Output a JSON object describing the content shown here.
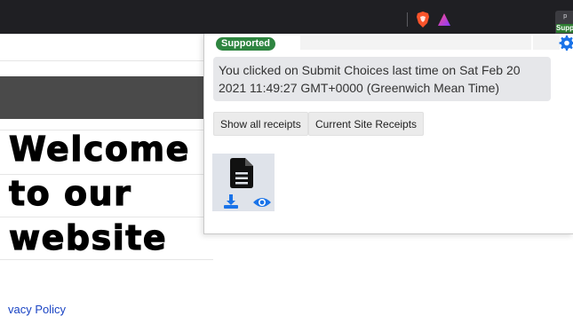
{
  "toolbar": {
    "extension_letter": "p",
    "extension_badge": "Supported"
  },
  "page": {
    "heading_lines": [
      "Welcome",
      "to our",
      "website"
    ],
    "privacy_link": "vacy Policy"
  },
  "popup": {
    "status_badge": "Supported",
    "message": "You clicked on Submit Choices last time on Sat Feb 20 2021 11:49:27 GMT+0000 (Greenwich Mean Time)",
    "buttons": {
      "show_all_receipts": "Show all receipts",
      "current_site_receipts": "Current Site Receipts"
    },
    "receipt_card": {
      "icons": [
        "document-icon",
        "download-icon",
        "eye-icon"
      ]
    }
  },
  "colors": {
    "badge_green": "#2e8540",
    "gear_blue": "#1a73e8",
    "icon_blue": "#1a73e8",
    "toolbar_dark": "#1f1f23",
    "brave_orange": "#fb542b"
  }
}
